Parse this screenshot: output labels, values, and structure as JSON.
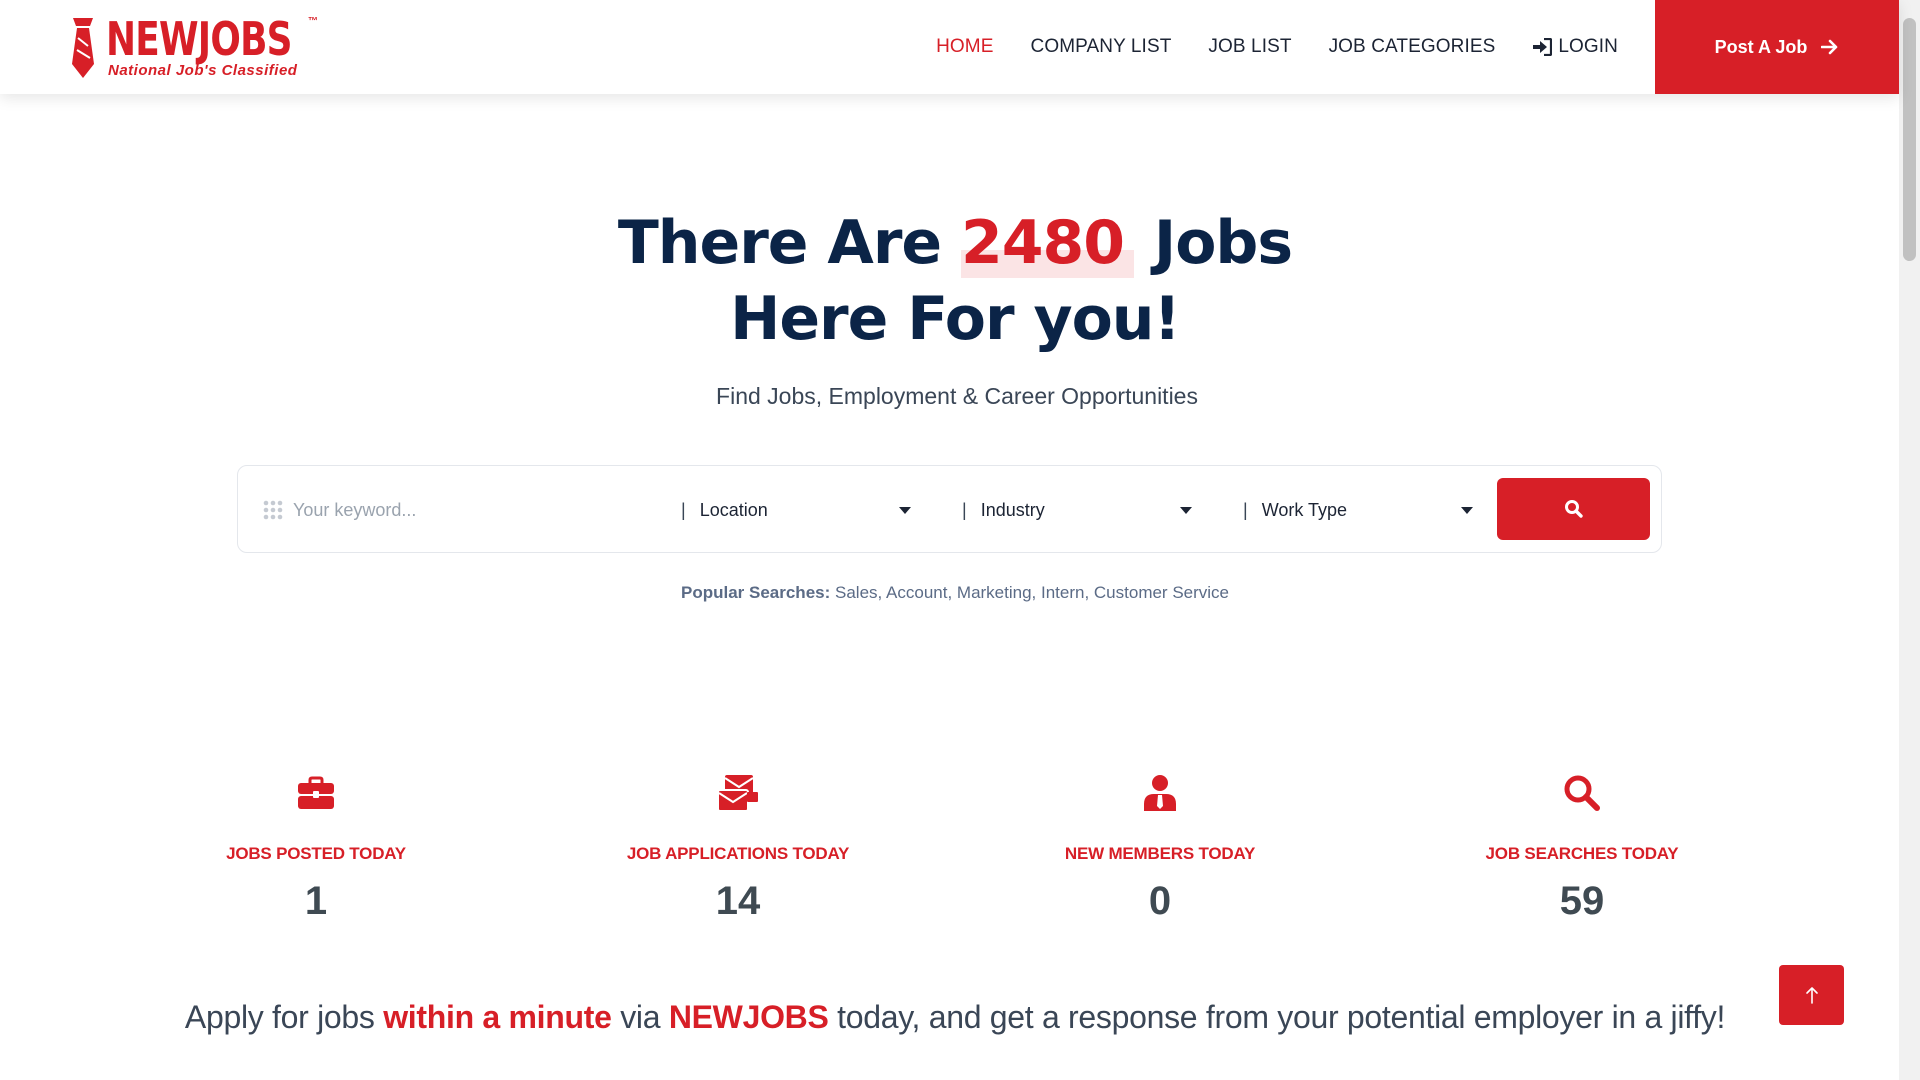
{
  "brand": {
    "name": "NEWJOBS",
    "trademark": "™",
    "tagline": "National Job's Classified",
    "color": "#d71f27"
  },
  "nav": {
    "items": [
      {
        "label": "HOME",
        "active": true
      },
      {
        "label": "COMPANY LIST",
        "active": false
      },
      {
        "label": "JOB LIST",
        "active": false
      },
      {
        "label": "JOB CATEGORIES",
        "active": false
      },
      {
        "label": "LOGIN",
        "active": false,
        "icon": "sign-in-icon"
      }
    ],
    "post_job": "Post A Job"
  },
  "hero": {
    "title_pre": "There Are ",
    "count": "2480",
    "title_post": " Jobs",
    "title_line2": "Here For you!",
    "subtitle": "Find Jobs, Employment & Career Opportunities"
  },
  "search": {
    "keyword_placeholder": "Your keyword...",
    "location": "Location",
    "industry": "Industry",
    "work_type": "Work Type",
    "pipe": "|"
  },
  "popular": {
    "label": "Popular Searches:",
    "terms": "Sales, Account, Marketing, Intern, Customer Service"
  },
  "stats": [
    {
      "label": "JOBS POSTED TODAY",
      "value": "1",
      "icon": "briefcase-icon"
    },
    {
      "label": "JOB APPLICATIONS TODAY",
      "value": "14",
      "icon": "mail-stack-icon"
    },
    {
      "label": "NEW MEMBERS TODAY",
      "value": "0",
      "icon": "user-tie-icon"
    },
    {
      "label": "JOB SEARCHES TODAY",
      "value": "59",
      "icon": "search-icon"
    }
  ],
  "tagline": {
    "p1": "Apply for jobs ",
    "h1": "within a minute",
    "p2": " via ",
    "h2": "NEWJOBS",
    "p3": " today, and get a response from your potential employer in a jiffy!"
  }
}
